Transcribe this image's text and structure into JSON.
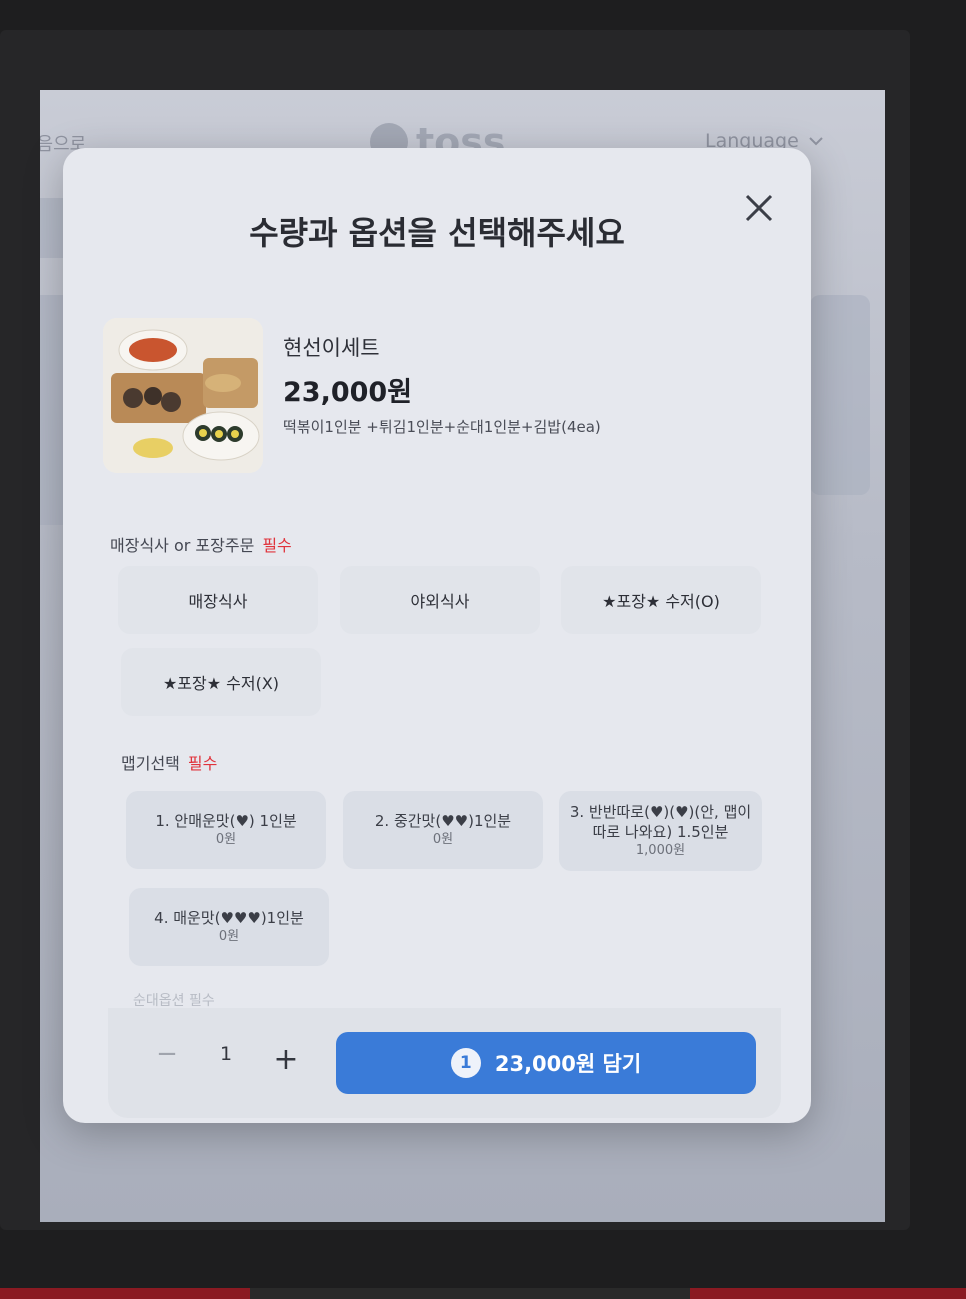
{
  "background": {
    "back_label": "처음으로",
    "logo_text": "toss",
    "language_label": "Language"
  },
  "modal": {
    "title": "수량과 옵션을 선택해주세요",
    "close_icon": "close-icon"
  },
  "product": {
    "name": "현선이세트",
    "price": "23,000원",
    "description": "떡볶이1인분 +튀김1인분+순대1인분+김밥(4ea)"
  },
  "dine_section": {
    "label": "매장식사 or 포장주문",
    "required": "필수",
    "options": [
      "매장식사",
      "야외식사",
      "★포장★ 수저(O)",
      "★포장★ 수저(X)"
    ]
  },
  "spicy_section": {
    "label": "맵기선택",
    "required": "필수",
    "options": [
      {
        "label": "1. 안매운맛(♥) 1인분",
        "price": "0원"
      },
      {
        "label": "2. 중간맛(♥♥)1인분",
        "price": "0원"
      },
      {
        "label": "3. 반반따로(♥)(♥)(안, 맵이 따로 나와요) 1.5인분",
        "price": "1,000원"
      },
      {
        "label": "4. 매운맛(♥♥♥)1인분",
        "price": "0원"
      }
    ]
  },
  "next_section_label": "순대옵션 필수",
  "quantity": {
    "minus": "−",
    "value": "1",
    "plus": "+"
  },
  "add_button": {
    "badge": "1",
    "label": "23,000원 담기"
  },
  "colors": {
    "primary": "#3a7bd8",
    "required": "#e0333c"
  }
}
